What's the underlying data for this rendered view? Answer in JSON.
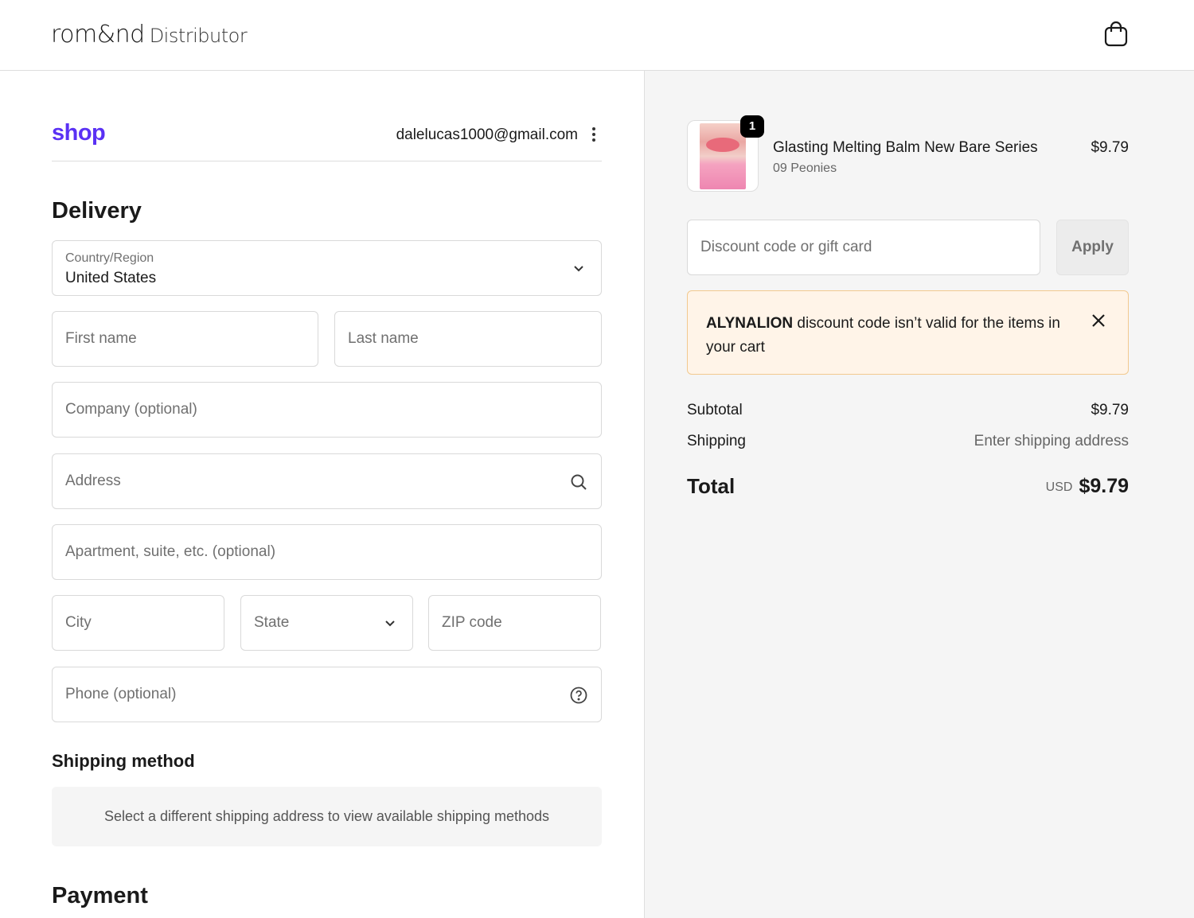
{
  "header": {
    "brand": "rom&nd",
    "brand_sub": "Distributor",
    "cart_icon": "shopping-bag-icon"
  },
  "account": {
    "shop_logo": "shop",
    "email": "dalelucas1000@gmail.com",
    "menu_icon": "kebab-menu-icon"
  },
  "delivery": {
    "title": "Delivery",
    "country_label": "Country/Region",
    "country_value": "United States",
    "first_name_placeholder": "First name",
    "last_name_placeholder": "Last name",
    "company_placeholder": "Company (optional)",
    "address_placeholder": "Address",
    "apartment_placeholder": "Apartment, suite, etc. (optional)",
    "city_placeholder": "City",
    "state_placeholder": "State",
    "zip_placeholder": "ZIP code",
    "phone_placeholder": "Phone (optional)"
  },
  "shipping_method": {
    "title": "Shipping method",
    "message": "Select a different shipping address to view available shipping methods"
  },
  "payment": {
    "title": "Payment"
  },
  "cart": {
    "item": {
      "name": "Glasting Melting Balm New Bare Series",
      "variant": "09 Peonies",
      "price": "$9.79",
      "quantity": "1"
    },
    "discount_placeholder": "Discount code or gift card",
    "apply_label": "Apply",
    "alert": {
      "code": "ALYNALION",
      "message": " discount code isn’t valid for the items in your cart"
    },
    "subtotal_label": "Subtotal",
    "subtotal_value": "$9.79",
    "shipping_label": "Shipping",
    "shipping_value": "Enter shipping address",
    "total_label": "Total",
    "total_currency": "USD",
    "total_value": "$9.79"
  },
  "colors": {
    "shop_brand": "#5a31f4",
    "alert_bg": "#fff4e8",
    "alert_border": "#f2c98f",
    "summary_bg": "#f5f5f5"
  }
}
